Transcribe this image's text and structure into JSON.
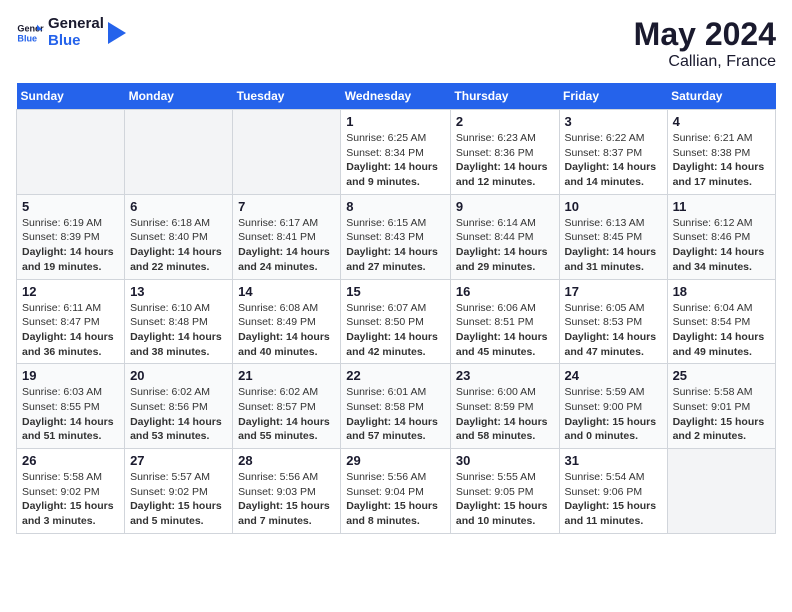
{
  "header": {
    "logo_general": "General",
    "logo_blue": "Blue",
    "month_year": "May 2024",
    "location": "Callian, France"
  },
  "weekdays": [
    "Sunday",
    "Monday",
    "Tuesday",
    "Wednesday",
    "Thursday",
    "Friday",
    "Saturday"
  ],
  "weeks": [
    [
      {
        "day": "",
        "info": ""
      },
      {
        "day": "",
        "info": ""
      },
      {
        "day": "",
        "info": ""
      },
      {
        "day": "1",
        "info": "Sunrise: 6:25 AM\nSunset: 8:34 PM\nDaylight: 14 hours and 9 minutes."
      },
      {
        "day": "2",
        "info": "Sunrise: 6:23 AM\nSunset: 8:36 PM\nDaylight: 14 hours and 12 minutes."
      },
      {
        "day": "3",
        "info": "Sunrise: 6:22 AM\nSunset: 8:37 PM\nDaylight: 14 hours and 14 minutes."
      },
      {
        "day": "4",
        "info": "Sunrise: 6:21 AM\nSunset: 8:38 PM\nDaylight: 14 hours and 17 minutes."
      }
    ],
    [
      {
        "day": "5",
        "info": "Sunrise: 6:19 AM\nSunset: 8:39 PM\nDaylight: 14 hours and 19 minutes."
      },
      {
        "day": "6",
        "info": "Sunrise: 6:18 AM\nSunset: 8:40 PM\nDaylight: 14 hours and 22 minutes."
      },
      {
        "day": "7",
        "info": "Sunrise: 6:17 AM\nSunset: 8:41 PM\nDaylight: 14 hours and 24 minutes."
      },
      {
        "day": "8",
        "info": "Sunrise: 6:15 AM\nSunset: 8:43 PM\nDaylight: 14 hours and 27 minutes."
      },
      {
        "day": "9",
        "info": "Sunrise: 6:14 AM\nSunset: 8:44 PM\nDaylight: 14 hours and 29 minutes."
      },
      {
        "day": "10",
        "info": "Sunrise: 6:13 AM\nSunset: 8:45 PM\nDaylight: 14 hours and 31 minutes."
      },
      {
        "day": "11",
        "info": "Sunrise: 6:12 AM\nSunset: 8:46 PM\nDaylight: 14 hours and 34 minutes."
      }
    ],
    [
      {
        "day": "12",
        "info": "Sunrise: 6:11 AM\nSunset: 8:47 PM\nDaylight: 14 hours and 36 minutes."
      },
      {
        "day": "13",
        "info": "Sunrise: 6:10 AM\nSunset: 8:48 PM\nDaylight: 14 hours and 38 minutes."
      },
      {
        "day": "14",
        "info": "Sunrise: 6:08 AM\nSunset: 8:49 PM\nDaylight: 14 hours and 40 minutes."
      },
      {
        "day": "15",
        "info": "Sunrise: 6:07 AM\nSunset: 8:50 PM\nDaylight: 14 hours and 42 minutes."
      },
      {
        "day": "16",
        "info": "Sunrise: 6:06 AM\nSunset: 8:51 PM\nDaylight: 14 hours and 45 minutes."
      },
      {
        "day": "17",
        "info": "Sunrise: 6:05 AM\nSunset: 8:53 PM\nDaylight: 14 hours and 47 minutes."
      },
      {
        "day": "18",
        "info": "Sunrise: 6:04 AM\nSunset: 8:54 PM\nDaylight: 14 hours and 49 minutes."
      }
    ],
    [
      {
        "day": "19",
        "info": "Sunrise: 6:03 AM\nSunset: 8:55 PM\nDaylight: 14 hours and 51 minutes."
      },
      {
        "day": "20",
        "info": "Sunrise: 6:02 AM\nSunset: 8:56 PM\nDaylight: 14 hours and 53 minutes."
      },
      {
        "day": "21",
        "info": "Sunrise: 6:02 AM\nSunset: 8:57 PM\nDaylight: 14 hours and 55 minutes."
      },
      {
        "day": "22",
        "info": "Sunrise: 6:01 AM\nSunset: 8:58 PM\nDaylight: 14 hours and 57 minutes."
      },
      {
        "day": "23",
        "info": "Sunrise: 6:00 AM\nSunset: 8:59 PM\nDaylight: 14 hours and 58 minutes."
      },
      {
        "day": "24",
        "info": "Sunrise: 5:59 AM\nSunset: 9:00 PM\nDaylight: 15 hours and 0 minutes."
      },
      {
        "day": "25",
        "info": "Sunrise: 5:58 AM\nSunset: 9:01 PM\nDaylight: 15 hours and 2 minutes."
      }
    ],
    [
      {
        "day": "26",
        "info": "Sunrise: 5:58 AM\nSunset: 9:02 PM\nDaylight: 15 hours and 3 minutes."
      },
      {
        "day": "27",
        "info": "Sunrise: 5:57 AM\nSunset: 9:02 PM\nDaylight: 15 hours and 5 minutes."
      },
      {
        "day": "28",
        "info": "Sunrise: 5:56 AM\nSunset: 9:03 PM\nDaylight: 15 hours and 7 minutes."
      },
      {
        "day": "29",
        "info": "Sunrise: 5:56 AM\nSunset: 9:04 PM\nDaylight: 15 hours and 8 minutes."
      },
      {
        "day": "30",
        "info": "Sunrise: 5:55 AM\nSunset: 9:05 PM\nDaylight: 15 hours and 10 minutes."
      },
      {
        "day": "31",
        "info": "Sunrise: 5:54 AM\nSunset: 9:06 PM\nDaylight: 15 hours and 11 minutes."
      },
      {
        "day": "",
        "info": ""
      }
    ]
  ]
}
